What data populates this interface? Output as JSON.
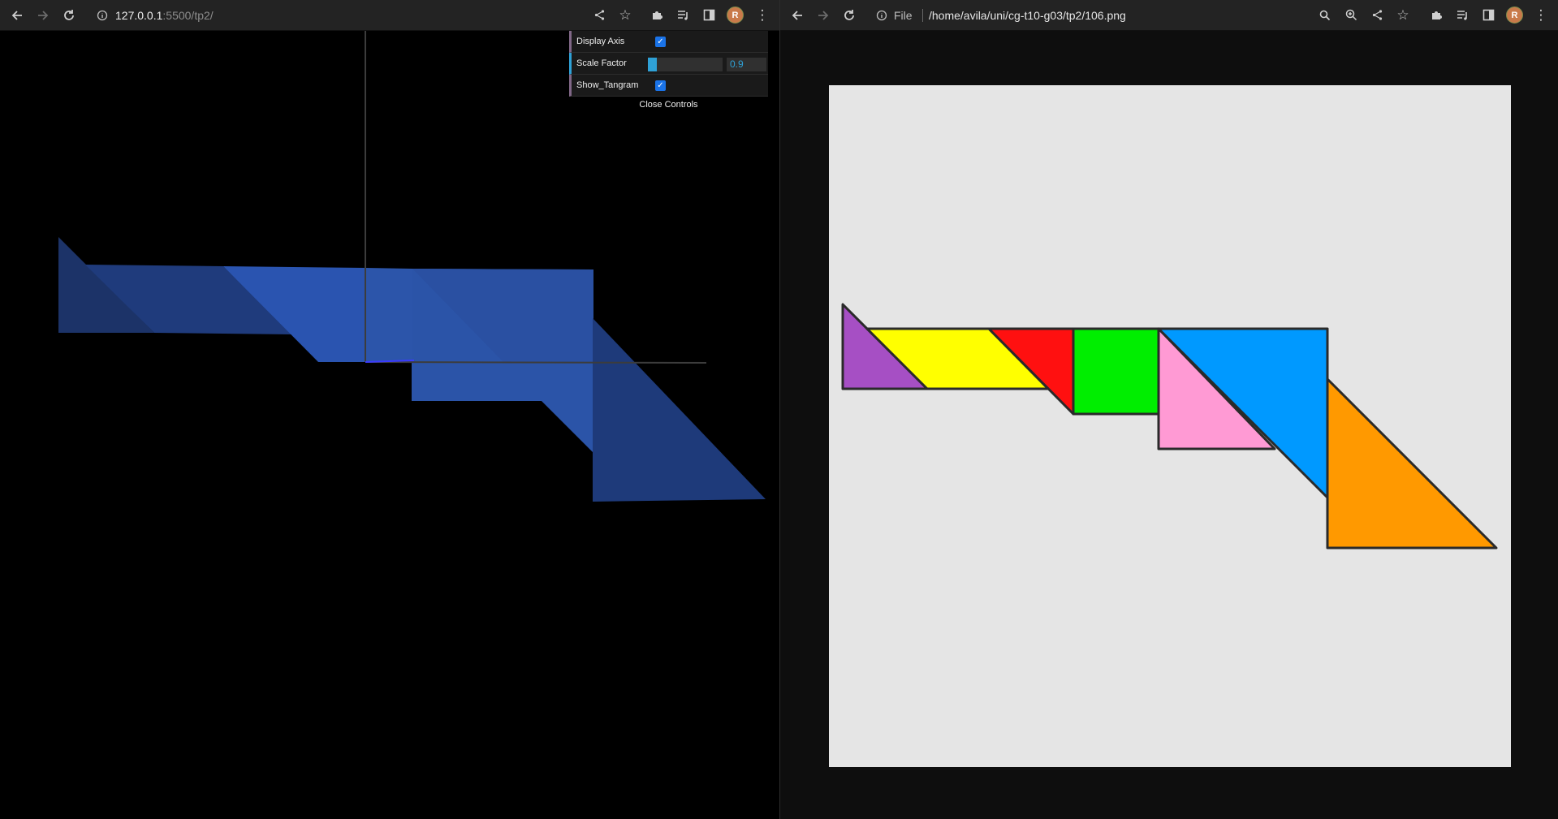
{
  "left_window": {
    "url": {
      "host": "127.0.0.1",
      "rest": ":5500/tp2/"
    },
    "gui": {
      "display_axis": {
        "label": "Display Axis",
        "checked": true
      },
      "scale_factor": {
        "label": "Scale Factor",
        "value": "0.9",
        "fraction": 0.12
      },
      "show_tangram": {
        "label": "Show_Tangram",
        "checked": true
      },
      "close_label": "Close Controls"
    },
    "colors": {
      "piece_blue": "#2b55b0",
      "piece_dark": "#1e3a7a",
      "axis": "#3a3a3a"
    }
  },
  "right_window": {
    "scheme": "File",
    "path": "/home/avila/uni/cg-t10-g03/tp2/106.png",
    "colors": {
      "purple": "#a64fc4",
      "yellow": "#ffff00",
      "red": "#ff1010",
      "green": "#00ee00",
      "pink": "#ff9ad4",
      "blue": "#0099ff",
      "orange": "#ff9900",
      "background": "#e5e5e5"
    }
  }
}
